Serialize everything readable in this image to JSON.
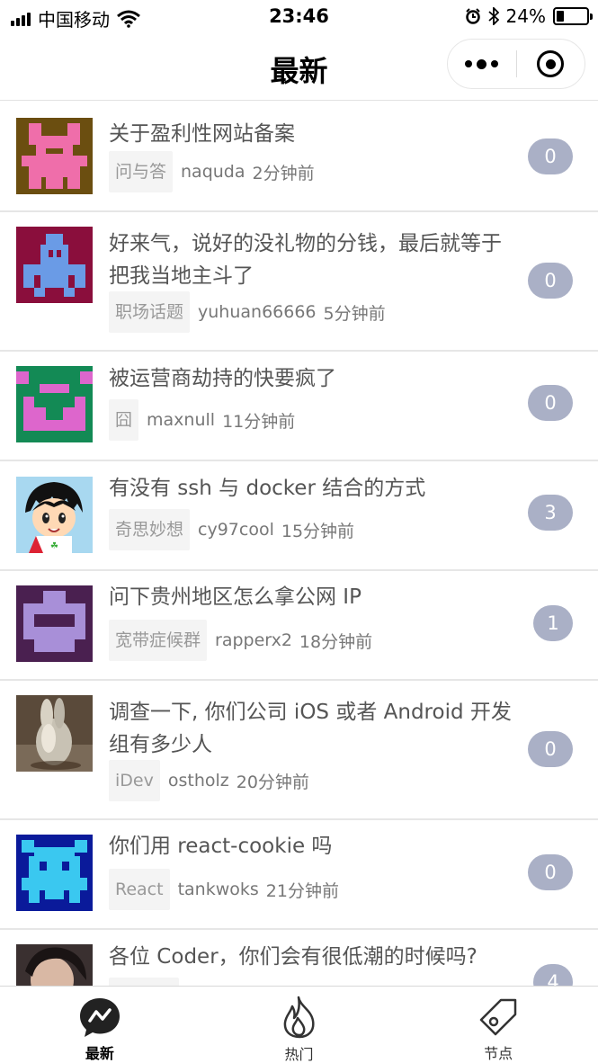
{
  "status_bar": {
    "carrier": "中国移动",
    "time": "23:46",
    "battery": "24%",
    "battery_level": 0.24
  },
  "nav": {
    "title": "最新"
  },
  "topics": [
    {
      "title": "关于盈利性网站备案",
      "node": "问与答",
      "author": "naquda",
      "time": "2分钟前",
      "replies": "0"
    },
    {
      "title": "好来气，说好的没礼物的分钱，最后就等于把我当地主斗了",
      "node": "职场话题",
      "author": "yuhuan66666",
      "time": "5分钟前",
      "replies": "0"
    },
    {
      "title": "被运营商劫持的快要疯了",
      "node": "囧",
      "author": "maxnull",
      "time": "11分钟前",
      "replies": "0"
    },
    {
      "title": "有没有 ssh 与 docker 结合的方式",
      "node": "奇思妙想",
      "author": "cy97cool",
      "time": "15分钟前",
      "replies": "3"
    },
    {
      "title": "问下贵州地区怎么拿公网 IP",
      "node": "宽带症候群",
      "author": "rapperx2",
      "time": "18分钟前",
      "replies": "1"
    },
    {
      "title": "调查一下, 你们公司 iOS 或者 Android 开发组有多少人",
      "node": "iDev",
      "author": "ostholz",
      "time": "20分钟前",
      "replies": "0"
    },
    {
      "title": "你们用 react-cookie 吗",
      "node": "React",
      "author": "tankwoks",
      "time": "21分钟前",
      "replies": "0"
    },
    {
      "title": "各位 Coder，你们会有很低潮的时候吗?",
      "node": "",
      "author": "",
      "time": "",
      "replies": "4"
    }
  ],
  "tabs": [
    {
      "label": "最新",
      "icon": "chat-bubble-icon"
    },
    {
      "label": "热门",
      "icon": "flame-icon"
    },
    {
      "label": "节点",
      "icon": "tag-icon"
    }
  ]
}
